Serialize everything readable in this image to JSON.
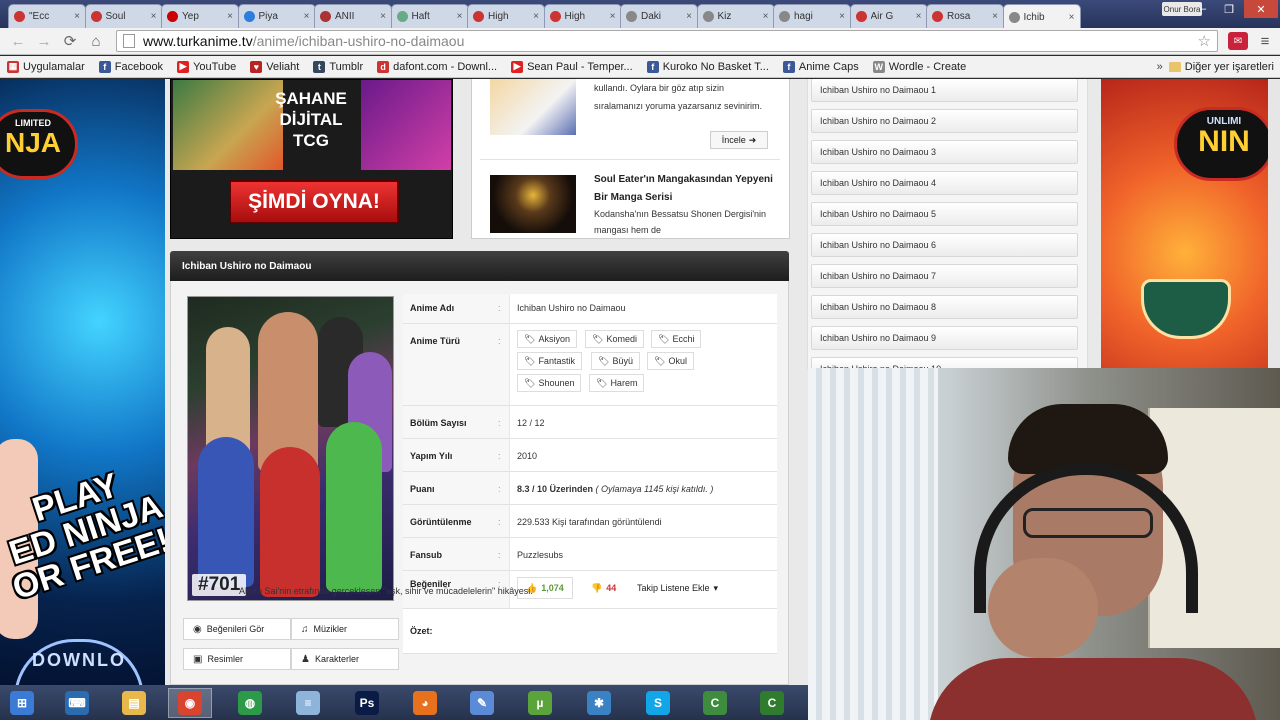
{
  "browser": {
    "tabs": [
      {
        "title": "\"Ecc",
        "color": "#c33"
      },
      {
        "title": "Soul",
        "color": "#c33"
      },
      {
        "title": "Yep",
        "color": "#c00"
      },
      {
        "title": "Piya",
        "color": "#2d7ddd"
      },
      {
        "title": "ANİI",
        "color": "#a33"
      },
      {
        "title": "Haft",
        "color": "#6a8"
      },
      {
        "title": "High",
        "color": "#c33"
      },
      {
        "title": "High",
        "color": "#c33"
      },
      {
        "title": "Daki",
        "color": "#888"
      },
      {
        "title": "Kiz",
        "color": "#888"
      },
      {
        "title": "hagi",
        "color": "#888"
      },
      {
        "title": "Air G",
        "color": "#c33"
      },
      {
        "title": "Rosa",
        "color": "#c33"
      },
      {
        "title": "Ichib",
        "color": "#888"
      }
    ],
    "user_badge": "Onur Bora",
    "url_host": "www.turkanime.tv",
    "url_path": "/anime/ichiban-ushiro-no-daimaou",
    "bookmarks": [
      {
        "label": "Uygulamalar",
        "color": "#c33",
        "glyph": "▦"
      },
      {
        "label": "Facebook",
        "color": "#3b5998",
        "glyph": "f"
      },
      {
        "label": "YouTube",
        "color": "#d22",
        "glyph": "▶"
      },
      {
        "label": "Veliaht",
        "color": "#b22",
        "glyph": "♥"
      },
      {
        "label": "Tumblr",
        "color": "#36465d",
        "glyph": "t"
      },
      {
        "label": "dafont.com - Downl...",
        "color": "#c33",
        "glyph": "d"
      },
      {
        "label": "Sean Paul - Temper...",
        "color": "#d22",
        "glyph": "▶"
      },
      {
        "label": "Kuroko No Basket T...",
        "color": "#3b5998",
        "glyph": "f"
      },
      {
        "label": "Anime Caps",
        "color": "#3b5998",
        "glyph": "f"
      },
      {
        "label": "Wordle - Create",
        "color": "#888",
        "glyph": "W"
      }
    ],
    "bookmarks_more": "»",
    "bookmarks_other": "Diğer yer işaretleri"
  },
  "ads": {
    "left_logo_line1": "LIMITED",
    "left_logo_line2": "NJA",
    "left_play": "PLAY\nED NINJA\nOR FREE!!",
    "left_download": "DOWNLO",
    "promo_title": "ŞAHANE\nDİJİTAL\nTCG",
    "promo_cta": "ŞİMDİ OYNA!",
    "right_logo_line1": "UNLIMI",
    "right_logo_line2": "NIN"
  },
  "news": {
    "item1_text": "kullandı. Oylara bir göz atıp sizin sıralamanızı yoruma yazarsanız sevinirim.",
    "item1_button": "İncele",
    "item2_title": "Soul Eater'ın Mangakasından Yepyeni Bir Manga Serisi",
    "item2_desc": "Kodansha'nın Bessatsu Shonen Dergisi'nin mangası hem de"
  },
  "anime": {
    "header": "Ichiban Ushiro no Daimaou",
    "poster_number": "#701",
    "side_buttons": [
      {
        "label": "Beğenileri Gör",
        "icon": "◉"
      },
      {
        "label": "Müzikler",
        "icon": "♫"
      },
      {
        "label": "Resimler",
        "icon": "▣"
      },
      {
        "label": "Karakterler",
        "icon": "♟"
      }
    ],
    "labels": {
      "name": "Anime Adı",
      "genre": "Anime Türü",
      "episodes": "Bölüm Sayısı",
      "year": "Yapım Yılı",
      "score": "Puanı",
      "views": "Görüntülenme",
      "fansub": "Fansub",
      "likes": "Beğeniler",
      "summary": "Özet:"
    },
    "sep": ":",
    "name": "Ichiban Ushiro no Daimaou",
    "genres": [
      "Aksiyon",
      "Komedi",
      "Ecchi",
      "Fantastik",
      "Büyü",
      "Okul",
      "Shounen",
      "Harem"
    ],
    "episodes": "12 / 12",
    "year": "2010",
    "score_main": "8.3 / 10 Üzerinden",
    "score_votes": "( Oylamaya 1145 kişi katıldı. )",
    "views": "229.533 Kişi tarafından görüntülendi",
    "fansub": "Puzzlesubs",
    "like_count": "1,074",
    "dislike_count": "44",
    "follow_label": "Takip Listene Ekle",
    "desc_preview": "Akuto Sai'nin etrafında gerçekleşen \"aşk, sihir ve mücadelelerin\" hikâyesi."
  },
  "episodes": [
    "Ichiban Ushiro no Daimaou 1",
    "Ichiban Ushiro no Daimaou 2",
    "Ichiban Ushiro no Daimaou 3",
    "Ichiban Ushiro no Daimaou 4",
    "Ichiban Ushiro no Daimaou 5",
    "Ichiban Ushiro no Daimaou 6",
    "Ichiban Ushiro no Daimaou 7",
    "Ichiban Ushiro no Daimaou 8",
    "Ichiban Ushiro no Daimaou 9",
    "Ichiban Ushiro no Daimaou 10"
  ],
  "taskbar": [
    {
      "name": "windows-start",
      "color": "#3a7bd5",
      "glyph": "⊞"
    },
    {
      "name": "remote-desktop",
      "color": "#2b6cb0",
      "glyph": "⌨"
    },
    {
      "name": "file-explorer",
      "color": "#e8b84a",
      "glyph": "▤"
    },
    {
      "name": "chrome",
      "color": "#d9442f",
      "glyph": "◉"
    },
    {
      "name": "globe-app",
      "color": "#2d9a4a",
      "glyph": "◍"
    },
    {
      "name": "notepad",
      "color": "#8fb4d9",
      "glyph": "≡"
    },
    {
      "name": "photoshop",
      "color": "#0a1c45",
      "glyph": "Ps"
    },
    {
      "name": "firefox",
      "color": "#e8711d",
      "glyph": "◕"
    },
    {
      "name": "paint",
      "color": "#5b8ad6",
      "glyph": "✎"
    },
    {
      "name": "utorrent",
      "color": "#5ba33b",
      "glyph": "µ"
    },
    {
      "name": "media-app",
      "color": "#3b82c4",
      "glyph": "✱"
    },
    {
      "name": "skype",
      "color": "#12a5e8",
      "glyph": "S"
    },
    {
      "name": "camtasia-1",
      "color": "#3e8d3e",
      "glyph": "C"
    },
    {
      "name": "camtasia-2",
      "color": "#2f7c2f",
      "glyph": "C"
    }
  ]
}
